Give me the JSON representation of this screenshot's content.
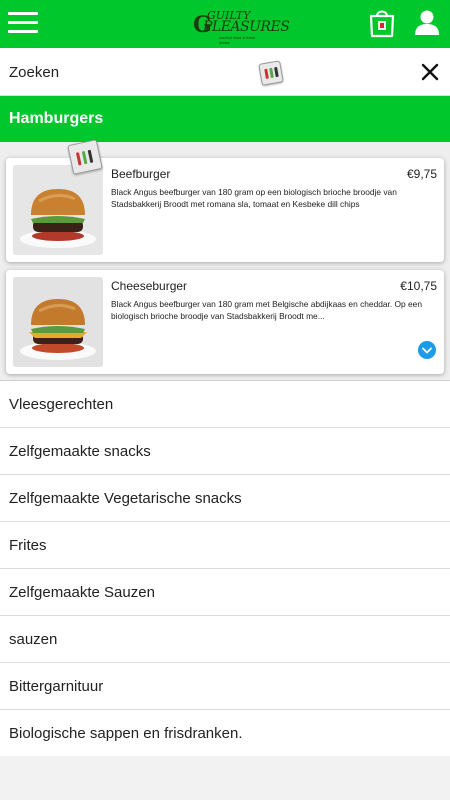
{
  "header": {
    "logo_line1": "GUILTY",
    "logo_line2": "PLEASURES",
    "logo_tagline": "comfort food & fresh drinks"
  },
  "search": {
    "placeholder": "Zoeken"
  },
  "category": {
    "title": "Hamburgers"
  },
  "products": [
    {
      "name": "Beefburger",
      "price": "€9,75",
      "description": "Black Angus beefburger van 180 gram op een biologisch brioche broodje van Stadsbakkerij Broodt met romana sla, tomaat en Kesbeke dill chips"
    },
    {
      "name": "Cheeseburger",
      "price": "€10,75",
      "description": "Black Angus beefburger van 180 gram met Belgische abdijkaas en cheddar. Op een biologisch brioche broodje van Stadsbakkerij Broodt me..."
    }
  ],
  "categories": [
    "Vleesgerechten",
    "Zelfgemaakte snacks",
    "Zelfgemaakte Vegetarische snacks",
    "Frites",
    "Zelfgemaakte Sauzen",
    "sauzen",
    "Bittergarnituur",
    "Biologische sappen en frisdranken."
  ],
  "colors": {
    "brand_green": "#00c72c",
    "accent_blue": "#1e9be8"
  },
  "icons": {
    "menu": "hamburger-menu-icon",
    "cart": "shopping-bag-icon",
    "account": "user-icon",
    "clear": "close-icon",
    "expand": "chevron-down-icon"
  }
}
